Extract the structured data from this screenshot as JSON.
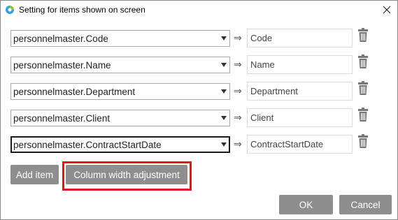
{
  "window": {
    "title": "Setting for items shown on screen",
    "icon": "app-logo-icon",
    "close_icon": "close-icon"
  },
  "items": [
    {
      "field": "personnelmaster.Code",
      "label": "Code",
      "focused": false
    },
    {
      "field": "personnelmaster.Name",
      "label": "Name",
      "focused": false
    },
    {
      "field": "personnelmaster.Department",
      "label": "Department",
      "focused": false
    },
    {
      "field": "personnelmaster.Client",
      "label": "Client",
      "focused": false
    },
    {
      "field": "personnelmaster.ContractStartDate",
      "label": "ContractStartDate",
      "focused": true
    }
  ],
  "arrow": "⇒",
  "buttons": {
    "add_item": "Add item",
    "column_width": "Column width adjustment",
    "ok": "OK",
    "cancel": "Cancel"
  },
  "colors": {
    "button_bg": "#8e8e8e",
    "highlight": "#e0161e"
  }
}
